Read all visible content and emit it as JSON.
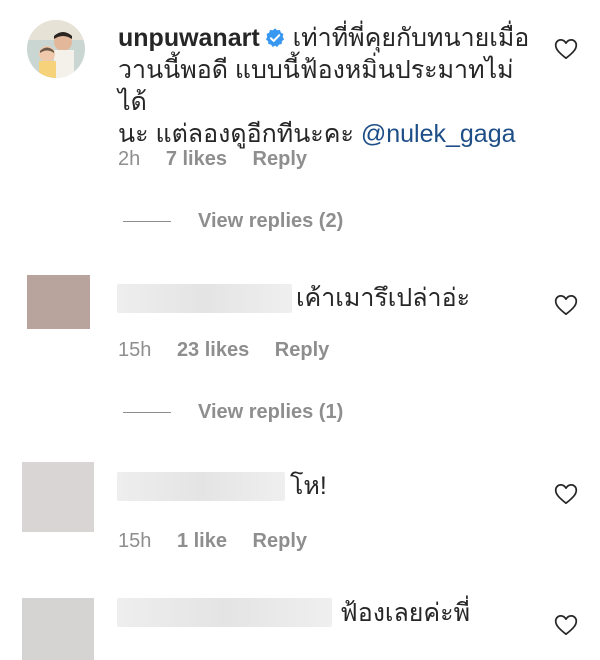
{
  "comments": [
    {
      "username": "unpuwanart",
      "text_line1": "เท่าที่พี่คุยกับทนายเมื่อ",
      "text_line2": "วานนี้พอดี แบบนี้ฟ้องหมิ่นประมาทไม่ได้",
      "text_line3_prefix": "นะ แต่ลองดูอีกทีนะคะ ",
      "mention": "@nulek_gaga",
      "time": "2h",
      "likes": "7 likes",
      "reply": "Reply",
      "view_replies": "View replies (2)"
    },
    {
      "text": "เค้าเมารึเปล่าอ่ะ",
      "time": "15h",
      "likes": "23 likes",
      "reply": "Reply",
      "view_replies": "View replies (1)"
    },
    {
      "text": "โห!",
      "time": "15h",
      "likes": "1 like",
      "reply": "Reply"
    },
    {
      "text": "ฟ้องเลยค่ะพี่"
    }
  ],
  "colors": {
    "text": "#262626",
    "muted": "#8e8e8e",
    "mention": "#1e4e87",
    "verified": "#3897f0"
  },
  "icons": {
    "like": "heart-outline-icon",
    "verified": "verified-badge-icon"
  }
}
